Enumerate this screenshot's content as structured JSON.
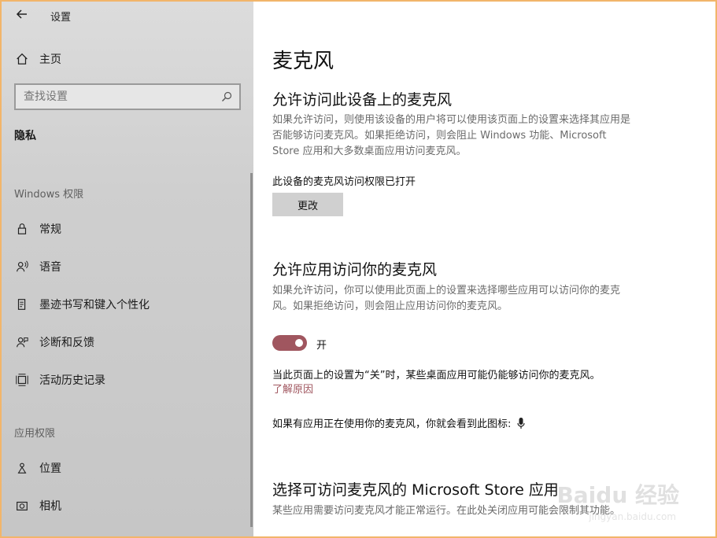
{
  "header": {
    "title": "设置"
  },
  "sidebar": {
    "home_label": "主页",
    "search": {
      "placeholder": "查找设置"
    },
    "category": "隐私",
    "section1": "Windows 权限",
    "windows_items": [
      {
        "label": "常规",
        "icon": "lock-icon"
      },
      {
        "label": "语音",
        "icon": "speech-icon"
      },
      {
        "label": "墨迹书写和键入个性化",
        "icon": "inking-icon"
      },
      {
        "label": "诊断和反馈",
        "icon": "diagnostics-icon"
      },
      {
        "label": "活动历史记录",
        "icon": "activity-icon"
      }
    ],
    "section2": "应用权限",
    "app_items": [
      {
        "label": "位置",
        "icon": "location-icon"
      },
      {
        "label": "相机",
        "icon": "camera-icon"
      }
    ]
  },
  "main": {
    "title": "麦克风",
    "s1": {
      "heading": "允许访问此设备上的麦克风",
      "desc": "如果允许访问，则使用该设备的用户将可以使用该页面上的设置来选择其应用是否能够访问麦克风。如果拒绝访问，则会阻止 Windows 功能、Microsoft Store 应用和大多数桌面应用访问麦克风。",
      "status": "此设备的麦克风访问权限已打开",
      "button": "更改"
    },
    "s2": {
      "heading": "允许应用访问你的麦克风",
      "desc": "如果允许访问，你可以使用此页面上的设置来选择哪些应用可以访问你的麦克风。如果拒绝访问，则会阻止应用访问你的麦克风。",
      "toggle_label": "开",
      "toggle_on": true,
      "note": "当此页面上的设置为“关”时，某些桌面应用可能仍能够访问你的麦克风。",
      "link": "了解原因",
      "indicator_text": "如果有应用正在使用你的麦克风，你就会看到此图标:"
    },
    "s3": {
      "heading": "选择可访问麦克风的 Microsoft Store 应用",
      "desc": "某些应用需要访问麦克风才能正常运行。在此处关闭应用可能会限制其功能。"
    }
  },
  "watermark": {
    "text": "Baidu 经验",
    "sub": "jingyan.baidu.com"
  },
  "colors": {
    "accent": "#a0565f",
    "sidebar_bg": "#d4d4d4",
    "frame": "#f2b56a"
  }
}
